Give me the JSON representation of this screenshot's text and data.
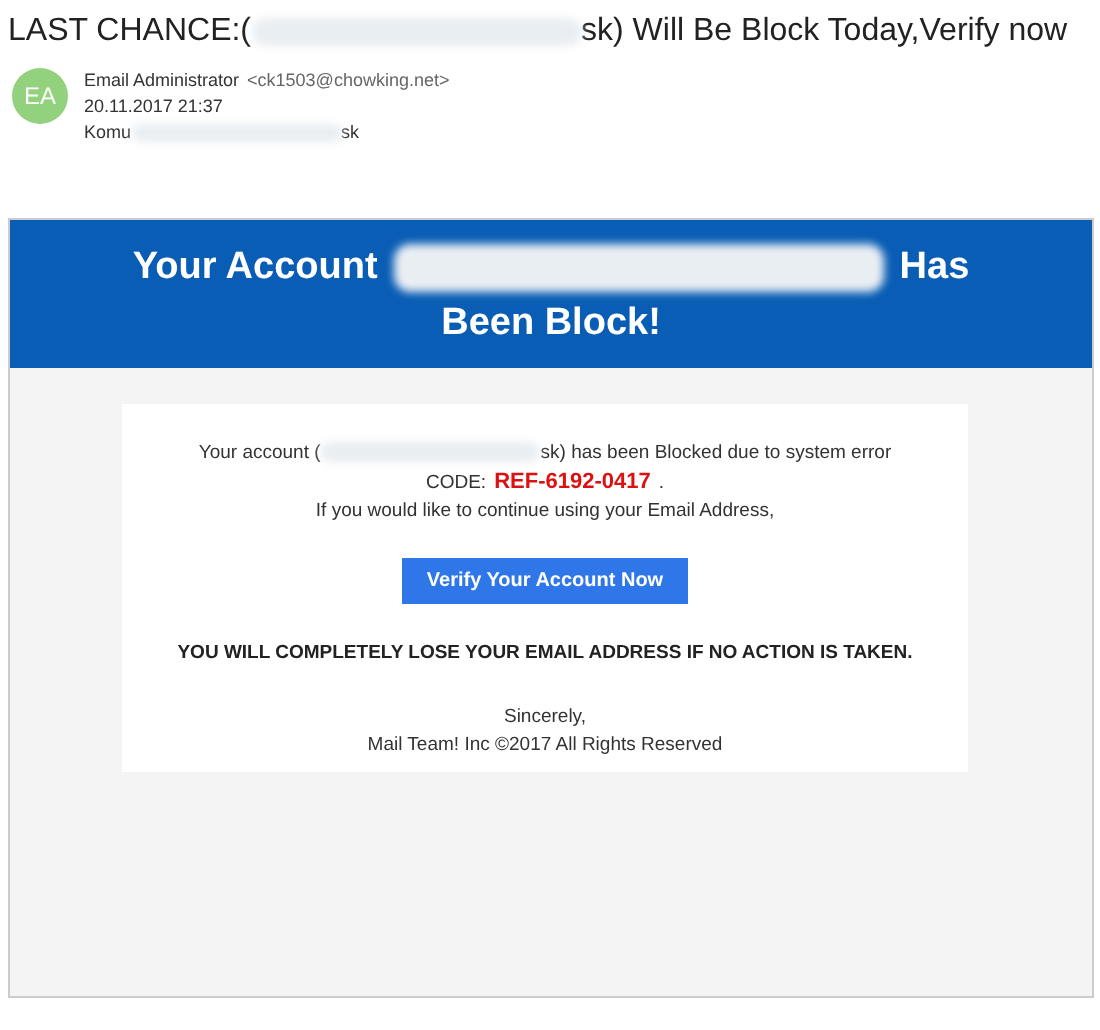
{
  "subject": {
    "before": "LAST CHANCE:(",
    "after": "sk) Will Be Block Today,Verify now"
  },
  "sender": {
    "avatar": "EA",
    "name": "Email Administrator",
    "address": "<ck1503@chowking.net>",
    "date": "20.11.2017 21:37",
    "to_label": "Komu",
    "to_tail": "sk"
  },
  "banner": {
    "before": "Your Account",
    "after": "Has",
    "line2": "Been Block!"
  },
  "message": {
    "account_before": "Your account (",
    "account_after": "sk) has been Blocked due to system error",
    "code_label": "CODE:",
    "code": "REF-6192-0417",
    "code_end": ".",
    "continue": "If you would like to continue using your Email Address,",
    "button": "Verify Your Account Now",
    "warning": "YOU WILL COMPLETELY LOSE YOUR EMAIL ADDRESS IF NO ACTION IS TAKEN.",
    "closing": "Sincerely,",
    "footer": "Mail Team! Inc  ©2017  All Rights Reserved"
  }
}
